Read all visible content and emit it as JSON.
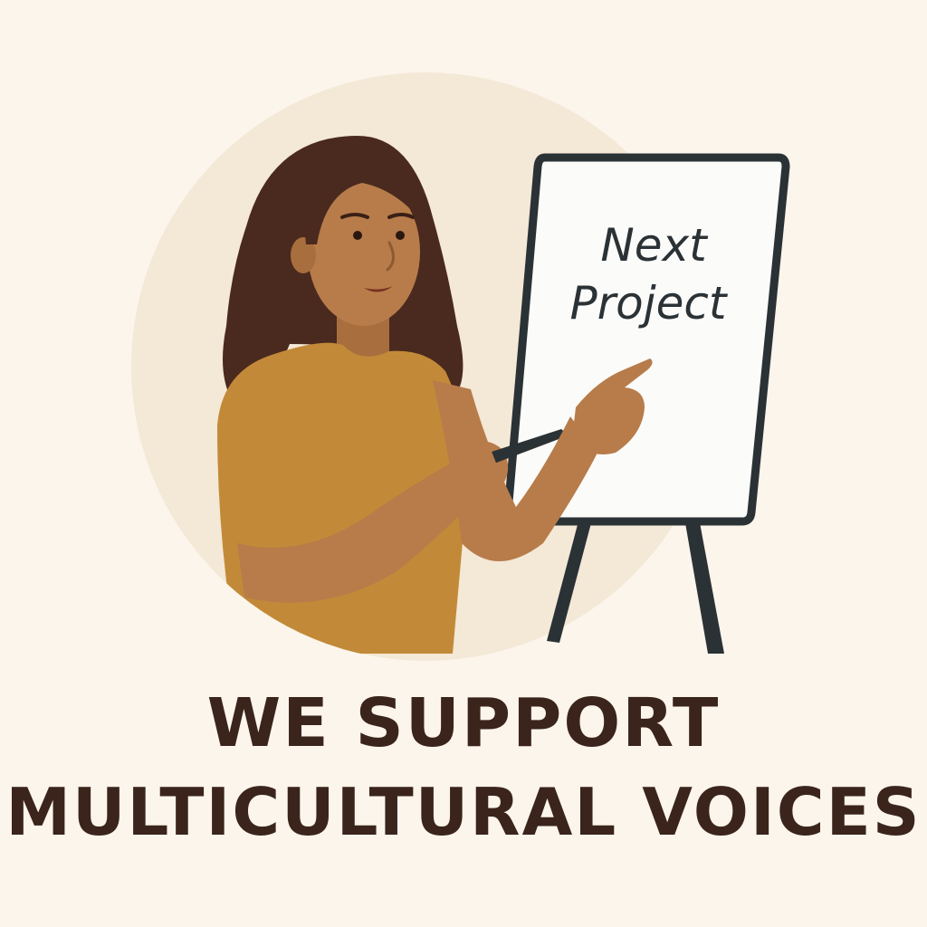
{
  "board": {
    "line1": "Next",
    "line2": "Project"
  },
  "headline": {
    "line1": "WE SUPPORT",
    "line2": "MULTICULTURAL VOICES"
  },
  "colors": {
    "background": "#fcf5eb",
    "circle": "#f4e8d7",
    "skin": "#b77c4a",
    "hair": "#4a2a1e",
    "shirt": "#c28a38",
    "board_frame": "#2b3236",
    "text": "#3a241c"
  }
}
